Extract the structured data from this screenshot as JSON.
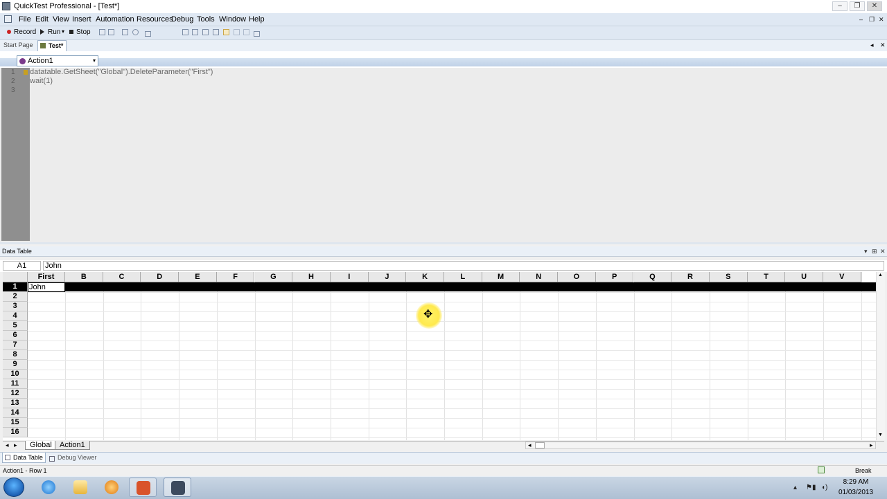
{
  "window": {
    "title": "QuickTest Professional - [Test*]",
    "min": "–",
    "max": "❐",
    "close": "✕"
  },
  "menu": {
    "items": [
      "File",
      "Edit",
      "View",
      "Insert",
      "Automation",
      "Resources",
      "Debug",
      "Tools",
      "Window",
      "Help"
    ],
    "mdi_min": "–",
    "mdi_restore": "❐",
    "mdi_close": "✕"
  },
  "toolbar": {
    "record": "Record",
    "run": "Run",
    "run_arrow": "▾",
    "stop": "Stop"
  },
  "doctabs": {
    "start_page": "Start Page",
    "test": "Test*",
    "nav_left": "◂",
    "nav_close": "✕"
  },
  "action_selector": {
    "value": "Action1",
    "arrow": "▾"
  },
  "editor": {
    "lines": [
      {
        "num": "1",
        "code": "datatable.GetSheet(\"Global\").DeleteParameter(\"First\")"
      },
      {
        "num": "2",
        "code": "wait(1)"
      },
      {
        "num": "3",
        "code": ""
      }
    ]
  },
  "datatable": {
    "title": "Data Table",
    "pin": "▾",
    "float": "⊞",
    "close": "✕",
    "cell_ref": "A1",
    "cell_value": "John",
    "columns": [
      "First",
      "B",
      "C",
      "D",
      "E",
      "F",
      "G",
      "H",
      "I",
      "J",
      "K",
      "L",
      "M",
      "N",
      "O",
      "P",
      "Q",
      "R",
      "S",
      "T",
      "U",
      "V"
    ],
    "rows": [
      "1",
      "2",
      "3",
      "4",
      "5",
      "6",
      "7",
      "8",
      "9",
      "10",
      "11",
      "12",
      "13",
      "14",
      "15",
      "16"
    ],
    "a1": "John",
    "selected_row": 1,
    "sheets": [
      "Global",
      "Action1"
    ],
    "nav_left": "◂",
    "nav_right": "▸",
    "scroll_up": "▲",
    "scroll_down": "▼"
  },
  "bottom_tabs": {
    "data_table": "Data Table",
    "debug_viewer": "Debug Viewer"
  },
  "status": {
    "text": "Action1  - Row  1",
    "mode": "Break"
  },
  "cursor": {
    "icon": "move-cursor",
    "glyph": "✥"
  },
  "taskbar": {
    "time": "8:29 AM",
    "date": "01/03/2013",
    "apps": [
      "internet-explorer",
      "file-explorer",
      "media-player",
      "powerpoint",
      "quicktest"
    ],
    "tray_arrow": "▴",
    "tray_flag": "⚑",
    "tray_net": "▮",
    "tray_vol": "◖)"
  }
}
